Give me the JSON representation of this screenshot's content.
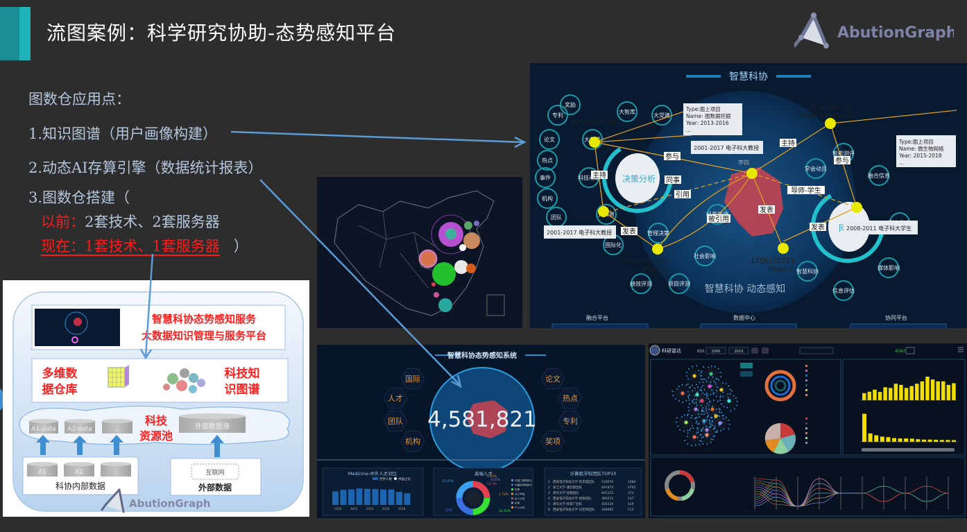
{
  "slide": {
    "title": "流图案例：科学研究协助-态势感知平台",
    "logo_text": "AbutionGraph",
    "accent_dark": "#1a8e92",
    "accent_light": "#1eb4ba",
    "arrow_color": "#5b9bd5"
  },
  "points": {
    "heading": "图数仓应用点：",
    "item1": "1.知识图谱（用户画像构建）",
    "item2": "2.动态AI存算引擎（数据统计报表）",
    "item3": "3.图数仓搭建（",
    "before_label": "以前：",
    "before_value": "2套技术、2套服务器",
    "now_text": "现在：1套技术、1套服务器",
    "close_paren": "）"
  },
  "architecture": {
    "service_line1": "智慧科协态势感知服务",
    "service_line2": "大数据知识管理与服务平台",
    "warehouse_line1": "多维数",
    "warehouse_line2": "据仓库",
    "kg_line1": "科技知",
    "kg_line2": "识图谱",
    "pool_line1": "科技",
    "pool_line2": "资源池",
    "db_a1data": "A1-data",
    "db_a2data": "A2-data",
    "db_more": "..",
    "db_external": "外部数据源",
    "db_a1": "A1",
    "db_a2": "A2",
    "internal_label": "科协内部数据",
    "internet": "互联网",
    "external_label": "外部数据",
    "logo_text": "AbutionGraph"
  },
  "knowledge_graph": {
    "title": "智慧科协",
    "subtitle": "智慧科协  动态感知",
    "left_hub": "决策分析",
    "right_hub": "网上",
    "tooltip1": [
      "Type:面上项目",
      "Name: 图数据挖掘",
      "Year: 2013-2016",
      "..."
    ],
    "tooltip2": [
      "Type:面上项目",
      "Name: 微生物网络",
      "Year: 2015-2018",
      "..."
    ],
    "role1": "2001-2017 电子科大教授",
    "role2": "2001-2017 电子科大教授",
    "role3": "2008-2011 电子科大学生",
    "node_person": "李四",
    "node_project_id": "2456334226",
    "node_project_type": "(Funded Project)",
    "node_project2_id": "6456834130",
    "node_paper1_id": "1256132271",
    "node_paper2_id": "6456137290",
    "node_paper_type": "(Paper)",
    "edges": [
      "主持",
      "参与",
      "同事",
      "引用",
      "被引用",
      "发表",
      "主持",
      "参与",
      "导师-学生",
      "发表",
      "发表"
    ],
    "satellites_left": [
      "专利",
      "奖励",
      "论文",
      "热点",
      "事件",
      "机构",
      "团队",
      "大学术",
      "大智库",
      "大党建",
      "科技动态",
      "大科普",
      "国际化",
      "管理决策",
      "经费预测",
      "社会影响",
      "绩效评测",
      "项目评测"
    ],
    "satellites_right": [
      "学会动员",
      "智能测评",
      "融合信息",
      "财务信息",
      "媒体影响",
      "智慧科协",
      "信息评估"
    ],
    "thumbs": [
      "融合平台",
      "数据中心",
      "协同平台"
    ]
  },
  "dashboard": {
    "title": "智慧科协态势感知系统",
    "total": "4,581,821",
    "hex_left": [
      "国际",
      "人才",
      "团队",
      "机构"
    ],
    "hex_right": [
      "论文",
      "热点",
      "专利",
      "奖项"
    ],
    "chart1_title": "Medicine-中外人才对比",
    "chart1_legend": [
      "世界人数",
      "中国占比"
    ],
    "chart1_years": [
      "2010",
      "2012",
      "2014",
      "2016",
      "2018"
    ],
    "chart1_values": [
      7000,
      7800,
      8000,
      8500,
      8300,
      8200,
      8000,
      8000,
      6800,
      6000
    ],
    "chart2_title": "高端人才",
    "chart2_labels": [
      "22.47%",
      "1.61%",
      "3.55%",
      "19.3%",
      "1.74%",
      "24.43%",
      "29%"
    ],
    "chart2_legend": [
      "中国工程院院士",
      "中国科学院院士",
      "杰青",
      "长江学者",
      "百人计划",
      "优青",
      "千人计划"
    ],
    "chart3_title": "计算机学科团队TOP10",
    "chart3_rows": [
      [
        "1",
        "西安电子科技大学-焦李成团队",
        "518970",
        "1684"
      ],
      [
        "2",
        "浙江大学-潘云鹤团队",
        "491475",
        "2765"
      ],
      [
        "3",
        "清华大学-张钹团队",
        "401125",
        "371"
      ],
      [
        "4",
        "西安电子科技大学-保铮团队",
        "380515",
        "147"
      ],
      [
        "5",
        "清华大学-孙家广团队",
        "355230",
        "429"
      ],
      [
        "6",
        "西安电子科技大学-刘宏伟团队",
        "348985",
        "512"
      ]
    ]
  },
  "radar": {
    "app_name": "科研雷达",
    "time_label": "时间:",
    "year_from": "2000",
    "year_to": "2019",
    "total_value": "4562",
    "bar_values_top": [
      30,
      36,
      45,
      35,
      55,
      52,
      70,
      65,
      52,
      60,
      70,
      80,
      100,
      88,
      80,
      80,
      65,
      72
    ],
    "bar_values_bottom": [
      150,
      45,
      35,
      28,
      25,
      20,
      18,
      18,
      17,
      14,
      12,
      12,
      11,
      10,
      10,
      9
    ]
  }
}
